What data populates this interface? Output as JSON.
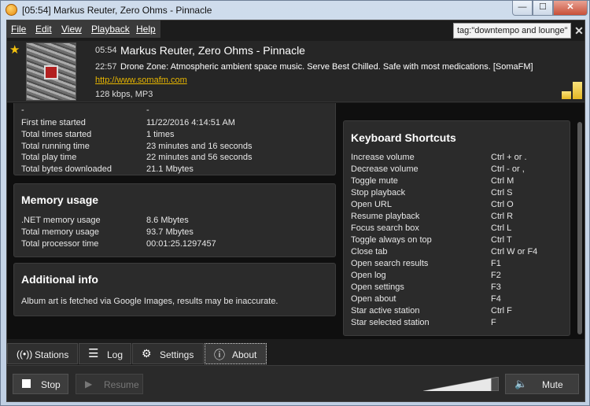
{
  "window": {
    "title": "[05:54] Markus Reuter, Zero Ohms - Pinnacle",
    "minimize_glyph": "—",
    "maximize_glyph": "☐",
    "close_glyph": "✕"
  },
  "menu": {
    "items": [
      "File",
      "Edit",
      "View",
      "Playback",
      "Help"
    ]
  },
  "search": {
    "value": "tag:\"downtempo and lounge\"",
    "clear_glyph": "✕"
  },
  "now_playing": {
    "track_time": "05:54",
    "track_title": "Markus Reuter, Zero Ohms - Pinnacle",
    "station_time": "22:57",
    "station_description": "Drone Zone: Atmospheric ambient space music. Serve Best Chilled. Safe with most medications. [SomaFM]",
    "station_url": "http://www.somafm.com",
    "bitrate": "128 kbps, MP3",
    "favorite_icon": "star-icon",
    "signal_icon": "signal-bars-icon"
  },
  "stats_panel": {
    "rows": [
      {
        "label": "-",
        "value": "-"
      },
      {
        "label": "First time started",
        "value": "11/22/2016 4:14:51 AM"
      },
      {
        "label": "Total times started",
        "value": "1 times"
      },
      {
        "label": "Total running time",
        "value": "23 minutes and 16 seconds"
      },
      {
        "label": "Total play time",
        "value": "22 minutes and 56 seconds"
      },
      {
        "label": "Total bytes downloaded",
        "value": "21.1 Mbytes"
      }
    ]
  },
  "memory_panel": {
    "title": "Memory usage",
    "rows": [
      {
        "label": ".NET memory usage",
        "value": "8.6 Mbytes"
      },
      {
        "label": "Total memory usage",
        "value": "93.7 Mbytes"
      },
      {
        "label": "Total processor time",
        "value": "00:01:25.1297457"
      }
    ]
  },
  "info_panel": {
    "title": "Additional info",
    "text": "Album art is fetched via Google Images, results may be inaccurate."
  },
  "shortcuts_panel": {
    "title": "Keyboard Shortcuts",
    "rows": [
      {
        "action": "Increase volume",
        "keys": "Ctrl + or ."
      },
      {
        "action": "Decrease volume",
        "keys": "Ctrl - or ,"
      },
      {
        "action": "Toggle mute",
        "keys": "Ctrl M"
      },
      {
        "action": "Stop playback",
        "keys": "Ctrl S"
      },
      {
        "action": "Open URL",
        "keys": "Ctrl O"
      },
      {
        "action": "Resume playback",
        "keys": "Ctrl R"
      },
      {
        "action": "Focus search box",
        "keys": "Ctrl L"
      },
      {
        "action": "Toggle always on top",
        "keys": "Ctrl T"
      },
      {
        "action": "Close tab",
        "keys": "Ctrl W or F4"
      },
      {
        "action": "Open search results",
        "keys": "F1"
      },
      {
        "action": "Open log",
        "keys": "F2"
      },
      {
        "action": "Open settings",
        "keys": "F3"
      },
      {
        "action": "Open about",
        "keys": "F4"
      },
      {
        "action": "Star active station",
        "keys": "Ctrl F"
      },
      {
        "action": "Star selected station",
        "keys": "F"
      }
    ]
  },
  "tabs": [
    {
      "label": "Stations",
      "icon": "broadcast-icon",
      "active": false
    },
    {
      "label": "Log",
      "icon": "list-icon",
      "active": false
    },
    {
      "label": "Settings",
      "icon": "gear-icon",
      "active": false
    },
    {
      "label": "About",
      "icon": "info-icon",
      "active": true
    }
  ],
  "controls": {
    "stop_label": "Stop",
    "resume_label": "Resume",
    "mute_label": "Mute",
    "volume_level": 0.9
  }
}
